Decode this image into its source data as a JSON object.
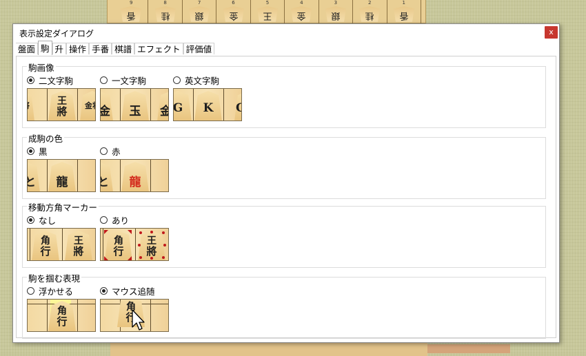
{
  "background_board": {
    "columns": [
      {
        "num": "9",
        "piece": "香"
      },
      {
        "num": "8",
        "piece": "桂"
      },
      {
        "num": "7",
        "piece": "銀"
      },
      {
        "num": "6",
        "piece": "金"
      },
      {
        "num": "5",
        "piece": "王"
      },
      {
        "num": "4",
        "piece": "金"
      },
      {
        "num": "3",
        "piece": "銀"
      },
      {
        "num": "2",
        "piece": "桂"
      },
      {
        "num": "1",
        "piece": "香"
      }
    ]
  },
  "dialog": {
    "title": "表示設定ダイアログ",
    "close_label": "x",
    "tabs": [
      "盤面",
      "駒",
      "升",
      "操作",
      "手番",
      "棋譜",
      "エフェクト",
      "評価値"
    ],
    "active_tab": "駒",
    "groups": {
      "piece_image": {
        "title": "駒画像",
        "options": [
          {
            "label": "二文字駒",
            "selected": true
          },
          {
            "label": "一文字駒",
            "selected": false
          },
          {
            "label": "英文字駒",
            "selected": false
          }
        ],
        "previews": [
          {
            "left": "銀将",
            "center_top": "王",
            "center_bottom": "將",
            "right": "金将"
          },
          {
            "left": "金",
            "center": "玉",
            "right": "金"
          },
          {
            "left": "G",
            "center": "K",
            "right": "G"
          }
        ]
      },
      "promoted_color": {
        "title": "成駒の色",
        "options": [
          {
            "label": "黒",
            "selected": true
          },
          {
            "label": "赤",
            "selected": false
          }
        ],
        "preview_chars": {
          "side": "と",
          "center": "龍"
        }
      },
      "move_marker": {
        "title": "移動方角マーカー",
        "options": [
          {
            "label": "なし",
            "selected": true
          },
          {
            "label": "あり",
            "selected": false
          }
        ],
        "preview_pieces": [
          {
            "top": "角",
            "bottom": "行"
          },
          {
            "top": "王",
            "bottom": "將"
          }
        ]
      },
      "grab_style": {
        "title": "駒を掴む表現",
        "options": [
          {
            "label": "浮かせる",
            "selected": false
          },
          {
            "label": "マウス追随",
            "selected": true
          }
        ],
        "preview_piece": {
          "top": "角",
          "bottom": "行"
        }
      }
    }
  },
  "colors": {
    "close_button": "#c7372f",
    "marker_red": "#c0181b",
    "promoted_red": "#d32a1c",
    "tatami": "#c7c79a"
  }
}
